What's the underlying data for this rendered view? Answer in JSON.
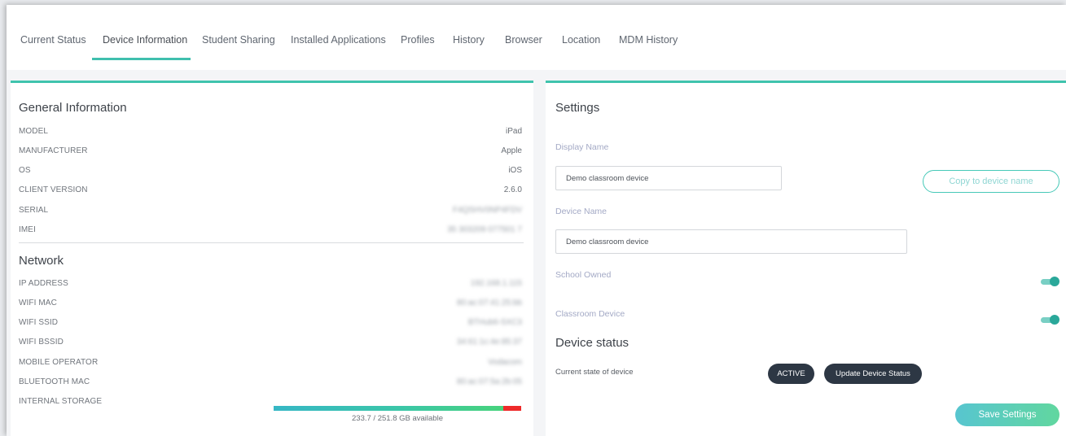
{
  "tabs": [
    {
      "label": "Current Status"
    },
    {
      "label": "Device Information"
    },
    {
      "label": "Student Sharing"
    },
    {
      "label": "Installed Applications"
    },
    {
      "label": "Profiles"
    },
    {
      "label": "History"
    },
    {
      "label": "Browser"
    },
    {
      "label": "Location"
    },
    {
      "label": "MDM History"
    }
  ],
  "active_tab": "Device Information",
  "general": {
    "title": "General Information",
    "rows": [
      {
        "label": "MODEL",
        "value": "iPad"
      },
      {
        "label": "MANUFACTURER",
        "value": "Apple"
      },
      {
        "label": "OS",
        "value": "iOS"
      },
      {
        "label": "CLIENT VERSION",
        "value": "2.6.0"
      },
      {
        "label": "SERIAL",
        "value": "F4QSHV0NP4FDV"
      },
      {
        "label": "IMEI",
        "value": "35 303209 077501 7"
      }
    ]
  },
  "network": {
    "title": "Network",
    "rows": [
      {
        "label": "IP ADDRESS",
        "value": "192.168.1.115"
      },
      {
        "label": "WIFI MAC",
        "value": "80:ac:07:41:25:bb"
      },
      {
        "label": "WIFI SSID",
        "value": "BTHub6-SXC3"
      },
      {
        "label": "WIFI BSSID",
        "value": "34:61:1c:4e:85:37"
      },
      {
        "label": "MOBILE OPERATOR",
        "value": "Vodacom"
      },
      {
        "label": "BLUETOOTH MAC",
        "value": "80:ac:07:5a:2b:05"
      },
      {
        "label": "INTERNAL STORAGE",
        "value": ""
      }
    ],
    "storage": {
      "text": "233.7 / 251.8 GB available",
      "available_fraction": 0.928,
      "used_fraction": 0.072
    }
  },
  "settings": {
    "title": "Settings",
    "display_name_label": "Display Name",
    "display_name_value": "Demo classroom device",
    "copy_button": "Copy to device name",
    "device_name_label": "Device Name",
    "device_name_value": "Demo classroom device",
    "school_owned_label": "School Owned",
    "school_owned": true,
    "classroom_device_label": "Classroom Device",
    "classroom_device": true
  },
  "device_status": {
    "title": "Device status",
    "current_state_label": "Current state of device",
    "state": "ACTIVE",
    "update_button": "Update Device Status"
  },
  "save_button": "Save Settings",
  "colors": {
    "accent": "#3fc3ad",
    "dark_pill": "#2d3744",
    "storage_red": "#ee2a2a"
  }
}
